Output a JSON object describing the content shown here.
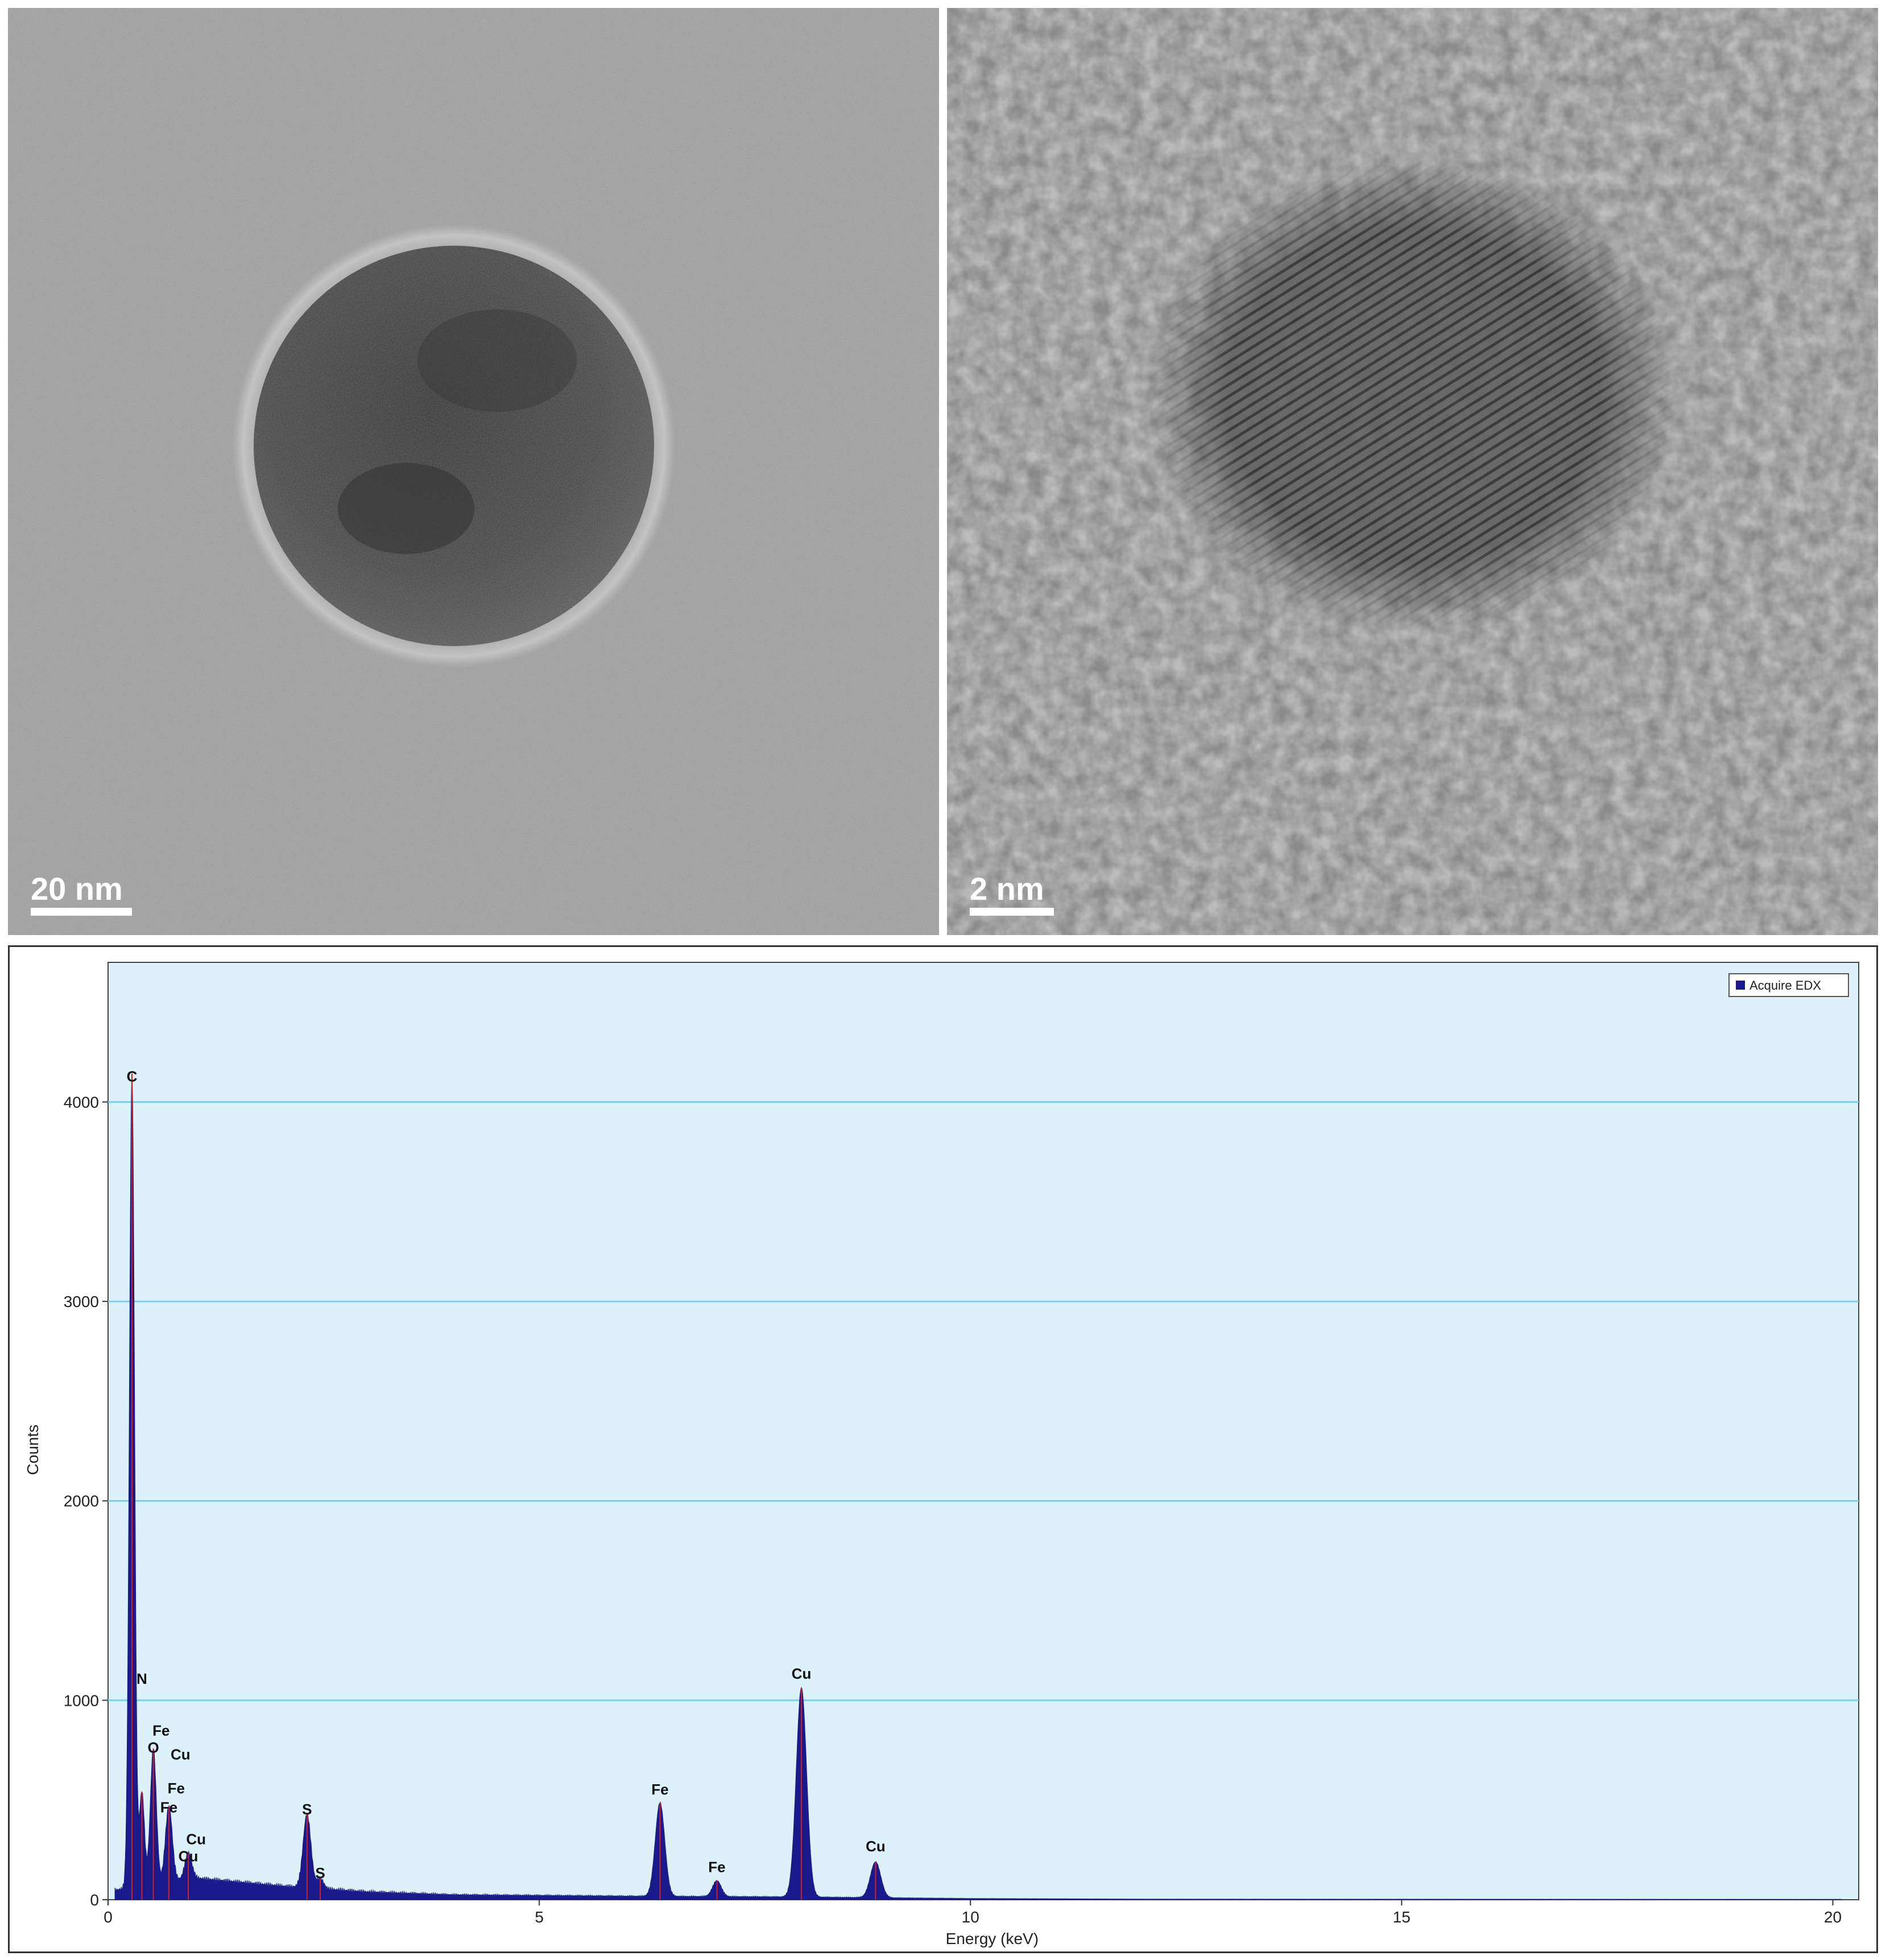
{
  "tem_left": {
    "scale_bar_label": "20 nm"
  },
  "tem_right": {
    "scale_bar_label": "2 nm"
  },
  "chart_data": {
    "type": "area",
    "title": "",
    "xlabel": "Energy (keV)",
    "ylabel": "Counts",
    "xlim": [
      0,
      20.3
    ],
    "ylim": [
      0,
      4700
    ],
    "x_ticks": [
      0,
      5,
      10,
      15,
      20
    ],
    "y_ticks": [
      0,
      1000,
      2000,
      3000,
      4000
    ],
    "grid": "horizontal",
    "legend_position": "top-right",
    "colors": {
      "plot_background": "#dcf1fa",
      "grid": "#7fd0e6",
      "fill": "#1a1a8c",
      "peak_marker": "#d42020"
    },
    "series": [
      {
        "name": "Acquire EDX",
        "peaks": [
          {
            "x": 0.277,
            "y": 4080,
            "w": 0.03
          },
          {
            "x": 0.392,
            "y": 470,
            "w": 0.03
          },
          {
            "x": 0.525,
            "y": 680,
            "w": 0.035
          },
          {
            "x": 0.705,
            "y": 380,
            "w": 0.04
          },
          {
            "x": 0.93,
            "y": 130,
            "w": 0.04
          },
          {
            "x": 2.307,
            "y": 370,
            "w": 0.045
          },
          {
            "x": 2.46,
            "y": 50,
            "w": 0.04
          },
          {
            "x": 6.4,
            "y": 470,
            "w": 0.055
          },
          {
            "x": 7.06,
            "y": 80,
            "w": 0.05
          },
          {
            "x": 8.04,
            "y": 1050,
            "w": 0.06
          },
          {
            "x": 8.9,
            "y": 180,
            "w": 0.06
          }
        ],
        "baseline": [
          [
            0.1,
            50
          ],
          [
            1.0,
            110
          ],
          [
            1.5,
            90
          ],
          [
            2.0,
            70
          ],
          [
            3.0,
            40
          ],
          [
            4.0,
            25
          ],
          [
            6.0,
            18
          ],
          [
            8.0,
            14
          ],
          [
            10.0,
            6
          ],
          [
            12.0,
            3
          ],
          [
            20.0,
            2
          ]
        ]
      }
    ],
    "annotations": [
      {
        "text": "C",
        "x": 0.277,
        "y": 4080
      },
      {
        "text": "N",
        "x": 0.392,
        "y": 1060
      },
      {
        "text": "Fe",
        "x": 0.615,
        "y": 800
      },
      {
        "text": "O",
        "x": 0.525,
        "y": 715
      },
      {
        "text": "Cu",
        "x": 0.84,
        "y": 680
      },
      {
        "text": "Fe",
        "x": 0.79,
        "y": 510
      },
      {
        "text": "Fe",
        "x": 0.705,
        "y": 415
      },
      {
        "text": "Cu",
        "x": 1.02,
        "y": 255
      },
      {
        "text": "Cu",
        "x": 0.93,
        "y": 170
      },
      {
        "text": "S",
        "x": 2.307,
        "y": 405
      },
      {
        "text": "S",
        "x": 2.46,
        "y": 85
      },
      {
        "text": "Fe",
        "x": 6.4,
        "y": 505
      },
      {
        "text": "Fe",
        "x": 7.06,
        "y": 115
      },
      {
        "text": "Cu",
        "x": 8.04,
        "y": 1085
      },
      {
        "text": "Cu",
        "x": 8.9,
        "y": 220
      }
    ]
  }
}
